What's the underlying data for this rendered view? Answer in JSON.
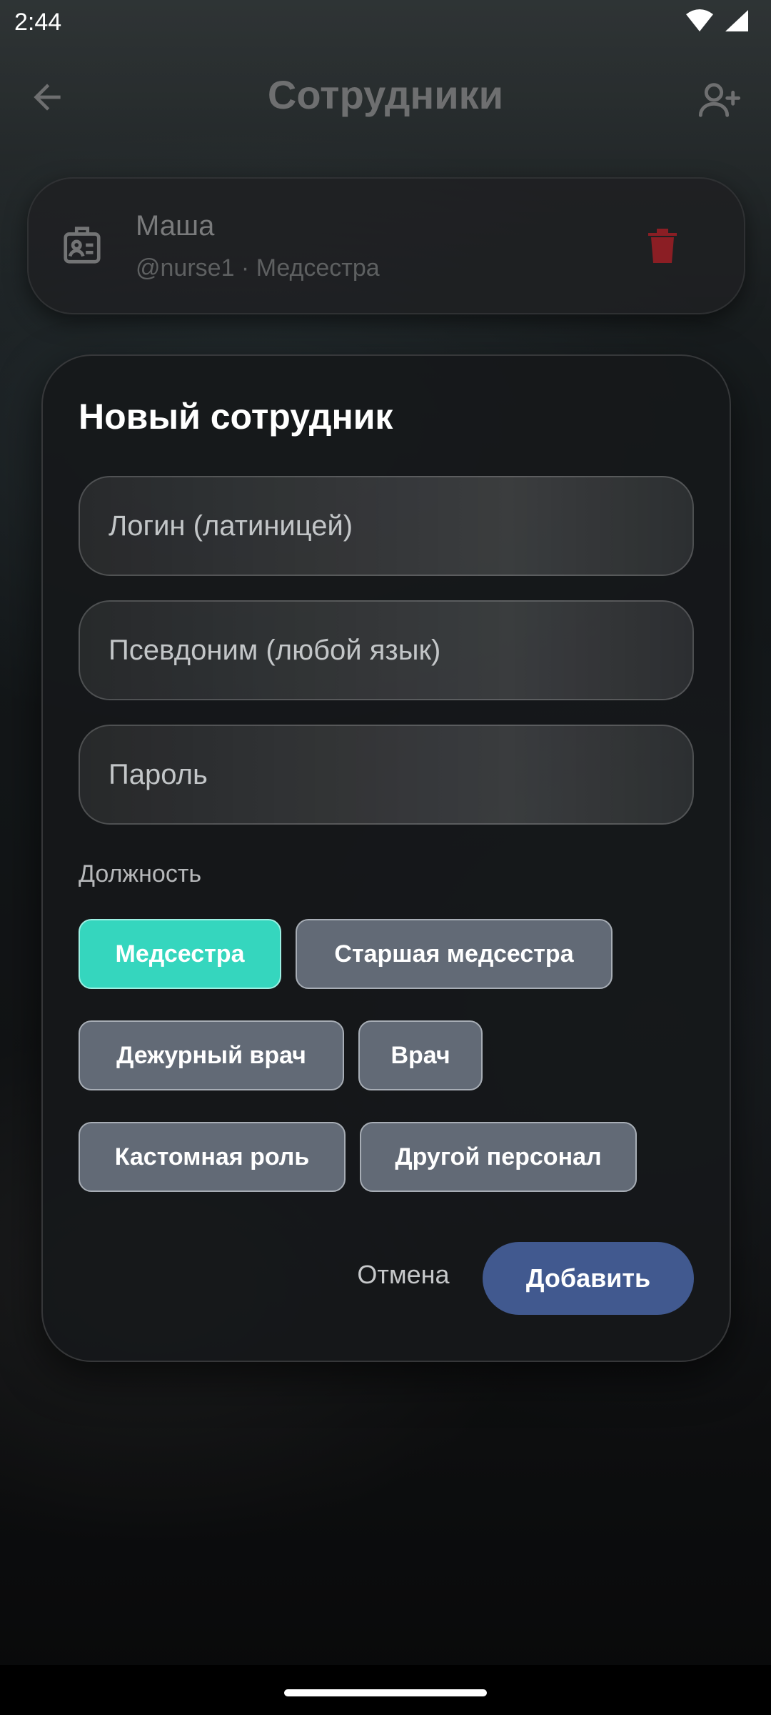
{
  "status_bar": {
    "time": "2:44"
  },
  "top_bar": {
    "title": "Сотрудники"
  },
  "staff": [
    {
      "name": "Маша",
      "meta": "@nurse1 · Медсестра"
    }
  ],
  "dialog": {
    "title": "Новый сотрудник",
    "fields": {
      "login": {
        "placeholder": "Логин (латиницей)",
        "value": ""
      },
      "nickname": {
        "placeholder": "Псевдоним (любой язык)",
        "value": ""
      },
      "password": {
        "placeholder": "Пароль",
        "value": ""
      }
    },
    "role_label": "Должность",
    "roles": [
      {
        "label": "Медсестра",
        "selected": true
      },
      {
        "label": "Старшая медсестра",
        "selected": false
      },
      {
        "label": "Дежурный врач",
        "selected": false
      },
      {
        "label": "Врач",
        "selected": false
      },
      {
        "label": "Кастомная роль",
        "selected": false
      },
      {
        "label": "Другой персонал",
        "selected": false
      }
    ],
    "cancel_label": "Отмена",
    "submit_label": "Добавить"
  },
  "colors": {
    "selected_chip": "#35d6be",
    "chip": "#626a76",
    "primary_button": "#41598f",
    "delete_icon": "#8b1e24"
  },
  "icons": [
    "back-arrow-icon",
    "add-person-icon",
    "badge-icon",
    "trash-icon",
    "wifi-icon",
    "signal-icon"
  ]
}
